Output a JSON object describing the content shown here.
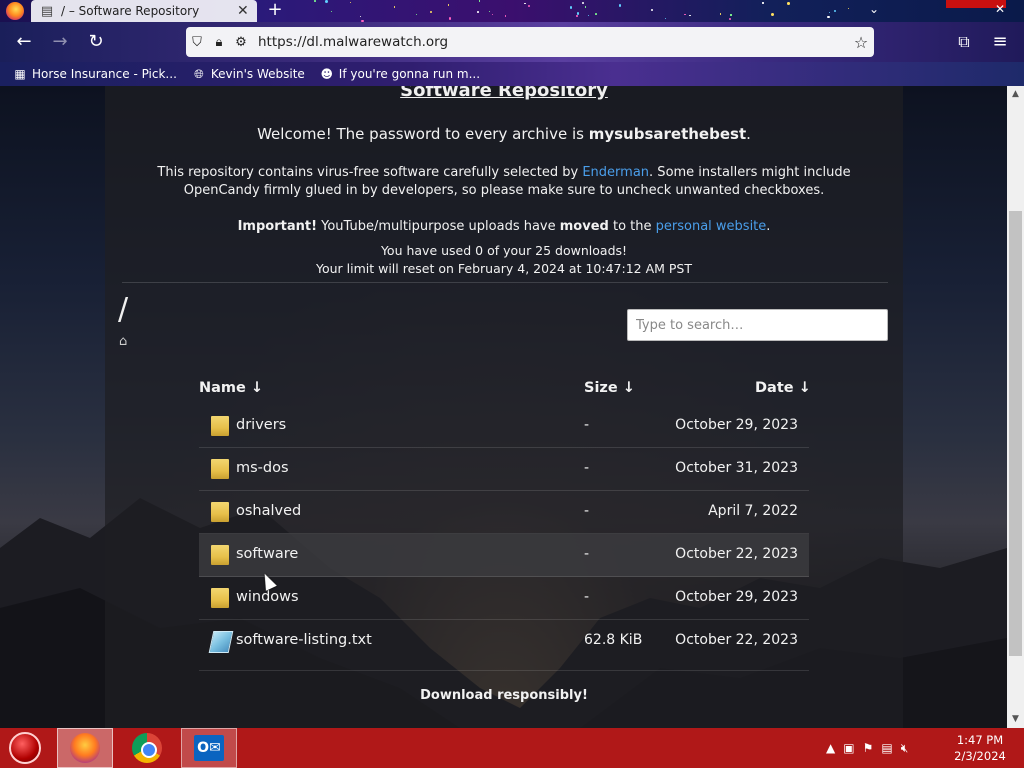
{
  "browser": {
    "tab_title": "/ – Software Repository",
    "tab_close": "✕",
    "new_tab": "+",
    "url": "https://dl.malwarewatch.org",
    "bookmarks": [
      {
        "label": "Horse Insurance - Pick..."
      },
      {
        "label": "Kevin's Website"
      },
      {
        "label": "If you're gonna run m..."
      }
    ]
  },
  "page": {
    "heading": "Software Repository",
    "welcome_prefix": "Welcome! The password to every archive is ",
    "password": "mysubsarethebest",
    "welcome_suffix": ".",
    "intro_prefix": "This repository contains virus-free software carefully selected by ",
    "intro_link": "Enderman",
    "intro_suffix": ". Some installers might include OpenCandy firmly glued in by developers, so please make sure to uncheck unwanted checkboxes.",
    "important_label": "Important!",
    "important_text1": " YouTube/multipurpose uploads have ",
    "important_moved": "moved",
    "important_text2": " to the ",
    "important_link": "personal website",
    "important_end": ".",
    "usage_line1": "You have used 0 of your 25 downloads!",
    "usage_line2": "Your limit will reset on February 4, 2024 at 10:47:12 AM PST",
    "path": "/",
    "search_placeholder": "Type to search…",
    "columns": {
      "name": "Name ↓",
      "size": "Size ↓",
      "date": "Date ↓"
    },
    "files": [
      {
        "name": "drivers",
        "size": "-",
        "date": "October 29, 2023",
        "type": "folder"
      },
      {
        "name": "ms-dos",
        "size": "-",
        "date": "October 31, 2023",
        "type": "folder"
      },
      {
        "name": "oshalved",
        "size": "-",
        "date": "April 7, 2022",
        "type": "folder"
      },
      {
        "name": "software",
        "size": "-",
        "date": "October 22, 2023",
        "type": "folder"
      },
      {
        "name": "windows",
        "size": "-",
        "date": "October 29, 2023",
        "type": "folder"
      },
      {
        "name": "software-listing.txt",
        "size": "62.8 KiB",
        "date": "October 22, 2023",
        "type": "text-file"
      }
    ],
    "footer": "Download responsibly!"
  },
  "taskbar": {
    "apps": [
      {
        "name": "firefox",
        "active": true
      },
      {
        "name": "chrome",
        "active": false
      },
      {
        "name": "outlook",
        "active": true
      }
    ],
    "time": "1:47 PM",
    "date": "2/3/2024"
  },
  "colors": {
    "link": "#4a9eea",
    "taskbar": "#b01818"
  }
}
